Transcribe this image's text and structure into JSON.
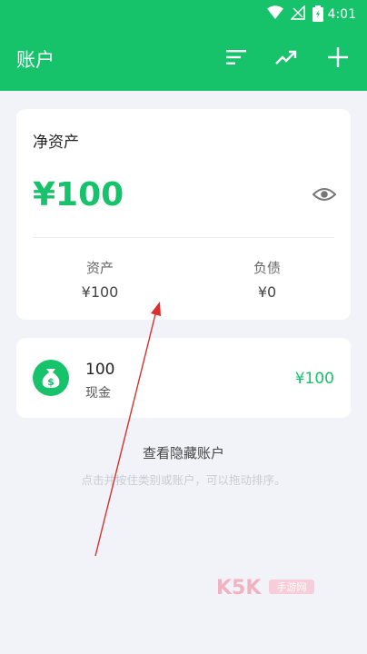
{
  "status_bar": {
    "time": "4:01"
  },
  "header": {
    "title": "账户",
    "icons": [
      "sort-icon",
      "trend-icon",
      "add-icon"
    ]
  },
  "net_assets": {
    "title": "净资产",
    "amount": "¥100",
    "assets_label": "资产",
    "assets_value": "¥100",
    "liabilities_label": "负债",
    "liabilities_value": "¥0"
  },
  "accounts": [
    {
      "name": "100",
      "type": "现金",
      "amount": "¥100",
      "icon": "money-bag-icon"
    }
  ],
  "hidden_accounts_label": "查看隐藏账户",
  "hint": "点击并按住类别或账户，可以拖动排序。",
  "watermark": {
    "text": "K5K",
    "sub": "手游网"
  },
  "colors": {
    "accent": "#16c26a",
    "background": "#f1f3f8",
    "annotation": "#d9302c"
  }
}
